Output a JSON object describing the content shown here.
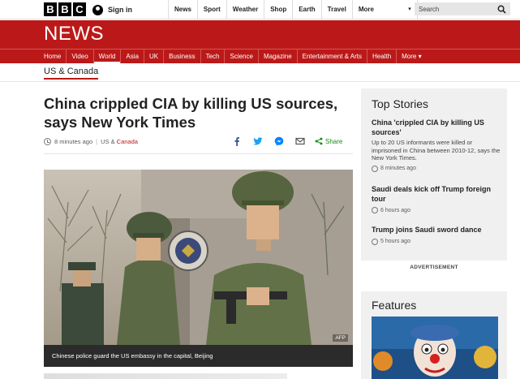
{
  "brand": {
    "letters": [
      "B",
      "B",
      "C"
    ]
  },
  "account": {
    "signin_label": "Sign in"
  },
  "topnav": {
    "items": [
      "News",
      "Sport",
      "Weather",
      "Shop",
      "Earth",
      "Travel"
    ],
    "more_label": "More",
    "search_placeholder": "Search"
  },
  "news": {
    "title": "NEWS",
    "subnav": [
      "Home",
      "Video",
      "World",
      "Asia",
      "UK",
      "Business",
      "Tech",
      "Science",
      "Magazine",
      "Entertainment & Arts",
      "Health",
      "More"
    ],
    "active": "World"
  },
  "section": {
    "label": "US & Canada"
  },
  "article": {
    "headline": "China crippled CIA by killing US sources, says New York Times",
    "time": "8 minutes ago",
    "sep": "|",
    "section_prefix": "US & ",
    "section_link": "Canada",
    "share_label": "Share",
    "photo_credit": "AFP",
    "caption": "Chinese police guard the US embassy in the capital, Beijing"
  },
  "top_stories": {
    "title": "Top Stories",
    "items": [
      {
        "title": "China 'crippled CIA by killing US sources'",
        "summary": "Up to 20 US informants were killed or imprisoned in China between 2010-12, says the New York Times.",
        "time": "8 minutes ago"
      },
      {
        "title": "Saudi deals kick off Trump foreign tour",
        "summary": "",
        "time": "6 hours ago"
      },
      {
        "title": "Trump joins Saudi sword dance",
        "summary": "",
        "time": "5 hours ago"
      }
    ]
  },
  "advertisement": {
    "label": "ADVERTISEMENT"
  },
  "features": {
    "title": "Features"
  },
  "colors": {
    "brand_red": "#bb1919",
    "share_green": "#1a8a1a",
    "panel_grey": "#f0f0f0"
  }
}
